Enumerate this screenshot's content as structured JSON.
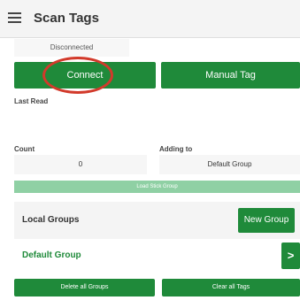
{
  "app": {
    "title": "Scan Tags"
  },
  "status": {
    "text": "Disconnected"
  },
  "buttons": {
    "connect": "Connect",
    "manual_tag": "Manual Tag",
    "load_stick_group": "Load Stick Group",
    "new_group": "New Group",
    "delete_all_groups": "Delete all Groups",
    "clear_all_tags": "Clear all Tags"
  },
  "last_read": {
    "label": "Last Read",
    "value": ""
  },
  "count": {
    "label": "Count",
    "value": "0"
  },
  "adding_to": {
    "label": "Adding to",
    "value": "Default Group"
  },
  "local_groups": {
    "title": "Local Groups",
    "items": [
      {
        "name": "Default Group",
        "chevron": ">"
      }
    ]
  },
  "colors": {
    "accent": "#1f8a3a",
    "disabled_accent": "#8fd0a4",
    "annotation_ring": "#d23a2b"
  },
  "icons": {
    "menu": "hamburger-menu-icon",
    "row_action": "chevron-right-icon"
  }
}
